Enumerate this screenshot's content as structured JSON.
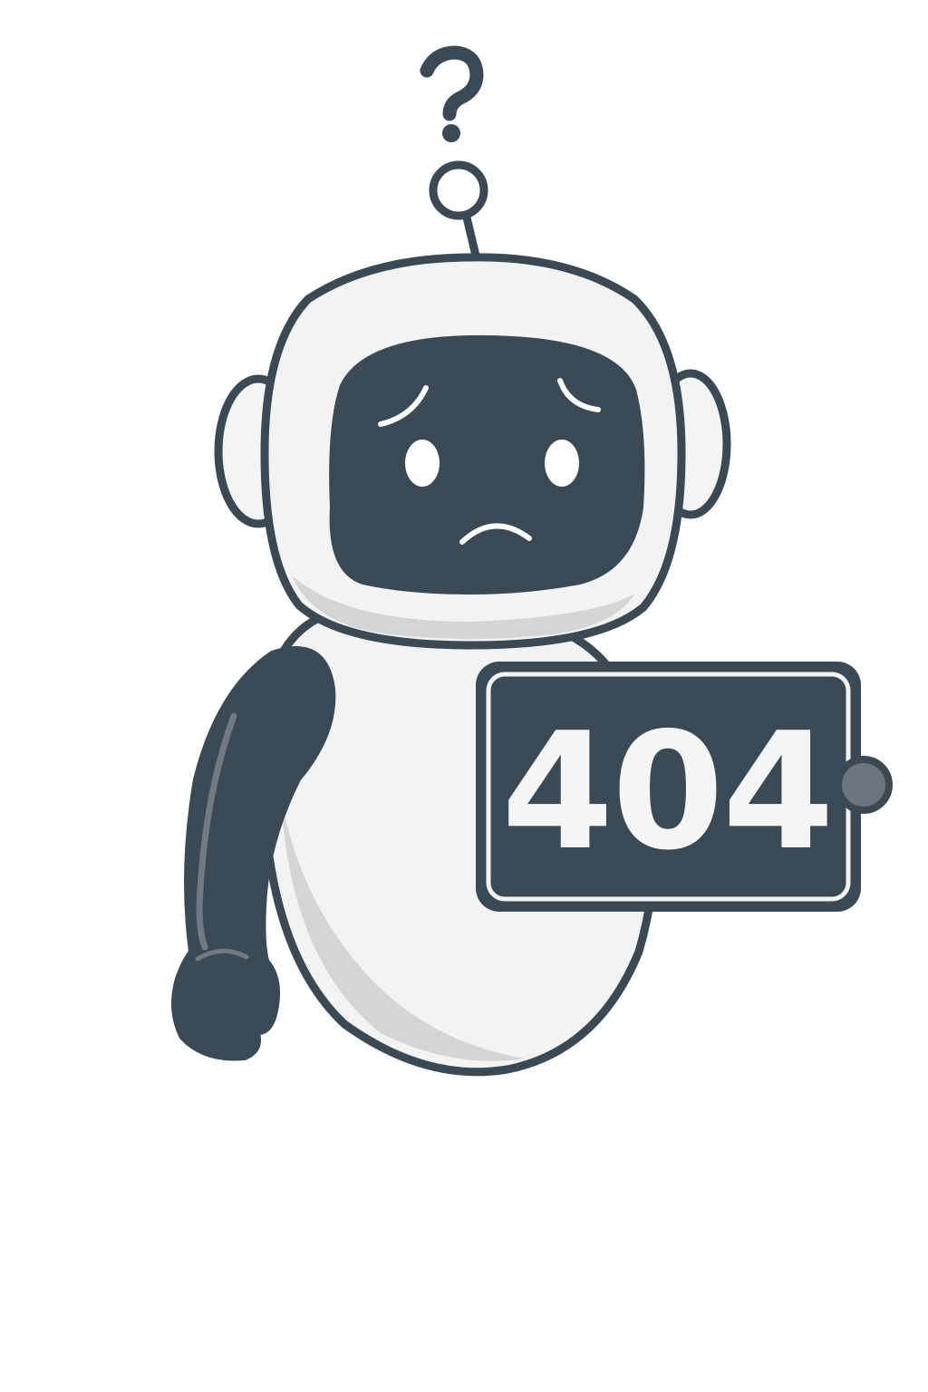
{
  "illustration": {
    "subject": "robot-mascot",
    "mood": "sad",
    "icons": {
      "question_mark": "question-mark-icon",
      "antenna": "antenna-icon"
    }
  },
  "sign": {
    "code": "404"
  },
  "colors": {
    "outline": "#3a4954",
    "visor": "#3a4954",
    "body_fill": "#f2f2f2",
    "body_shade": "#d4d5d6",
    "face_feature": "#ffffff",
    "sign_bg": "#3a4954",
    "sign_text": "#f5f5f5",
    "knob": "#6b757d",
    "background": "#ffffff"
  }
}
